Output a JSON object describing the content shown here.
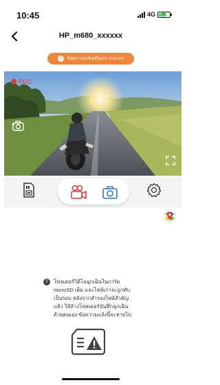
{
  "status_bar": {
    "time": "10:45",
    "network": "4G",
    "colors": {
      "battery": "#4cd964"
    }
  },
  "header": {
    "title": "HP_m680_xxxxxx"
  },
  "warning_banner": {
    "text": "ข้อความแจ้งเตือนจากระบบ",
    "color": "#f0863a"
  },
  "video": {
    "rec_label": "REC",
    "rec_color": "#e23b3b"
  },
  "toolbar": {
    "accent_color": "#e23b3b",
    "camera_color": "#2a7ac9",
    "items": [
      {
        "icon": "sd-card-file-icon"
      },
      {
        "icon": "video-camera-icon"
      },
      {
        "icon": "photo-camera-icon"
      },
      {
        "icon": "gear-icon"
      }
    ]
  },
  "notice": {
    "text": "โฟลเดอร์วิดีโอฉุกเฉินในการ์ด\nmicroSD เต็ม และไฟล์เก่าจะถูกทับ\nเป็นรอบ หลังจากสำรองไฟล์สำคัญ\nแล้ว ให้ล้างโฟลเดอร์บันทึกฉุกเฉิน\nด้วยตนเอง ข้อความแจ้งนี้จะหายไป"
  }
}
